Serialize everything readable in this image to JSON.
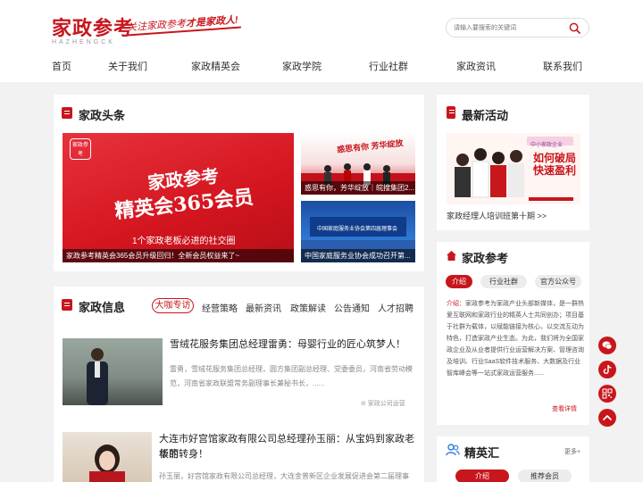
{
  "brand": {
    "logo_cn": "家政参考",
    "logo_en": "HAZHENGCK",
    "slogan_a": "关注家政参考",
    "slogan_b": "才是家政人!"
  },
  "search": {
    "placeholder": "请输入要搜索的关键词",
    "icon": "search-icon"
  },
  "nav": [
    "首页",
    "关于我们",
    "家政精英会",
    "家政学院",
    "行业社群",
    "家政资讯",
    "联系我们"
  ],
  "headlines": {
    "title": "家政头条",
    "main": {
      "caption": "家政参考精英会365会员升级回归！全新会员权益来了~",
      "img_line1": "家政参考",
      "img_line2": "精英会365会员",
      "img_line3": "1个家政老板必进的社交圈",
      "seal": "家政参考"
    },
    "side": [
      {
        "caption": "惑思有你，芳华绽放｜皖搜集团2...",
        "img_text": "惑思有你 芳华绽放"
      },
      {
        "caption": "中国家庭服务业协会成功召开第...",
        "img_text": "中国家庭服务业协会第四届理事会"
      }
    ]
  },
  "info": {
    "title": "家政信息",
    "tabs": [
      "大咖专访",
      "经营策略",
      "最新资讯",
      "政策解读",
      "公告通知",
      "人才招聘"
    ],
    "items": [
      {
        "title": "雪绒花服务集团总经理雷勇：母婴行业的匠心筑梦人！",
        "desc_line1": "雷勇，雪绒花服务集团总经理，圆方集团副总经理、党委委员，河南省劳动模",
        "desc_line2": "范，河南省家政联盟常务副理事长兼秘书长，......",
        "source": "家政公司运营"
      },
      {
        "title_line1": "大连市好宫馆家政有限公司总经理孙玉丽：从宝妈到家政老板的",
        "title_line2": "华丽转身！",
        "desc_line1": "孙玉丽，好宫馆家政有限公司总经理，大连金普新区企业发展促进会第二届理事"
      }
    ]
  },
  "activity": {
    "title": "最新活动",
    "caption": "家政经理人培训班第十期 >>",
    "img_tag": "中小家政企业",
    "img_line1": "如何破局",
    "img_line2": "快速盈利"
  },
  "reference": {
    "title": "家政参考",
    "tabs": [
      "介绍",
      "行业社群",
      "官方公众号"
    ],
    "intro_label": "介绍：",
    "intro_text": "家政参考为家政产业头部新媒体，是一群热爱互联网和家政行业的精英人士共同创办；项目基于社群为载体，以赋能链接为核心，以交流互动为特色，打造家政产业生态。为此，我们将为全国家政企业及从业者提供行业运营解决方案、管理咨询及培训、行业SaaS软件技术服务、大数据及行业智库峰会等一站式家政运营服务......",
    "more": "查看详情"
  },
  "elite": {
    "title": "精英汇",
    "more": "更多+",
    "tabs": [
      "介绍",
      "推荐会员"
    ]
  },
  "float_icons": [
    "wechat-icon",
    "douyin-icon",
    "qrcode-icon",
    "back-to-top-icon"
  ],
  "colors": {
    "brand_red": "#c8161d",
    "background": "#f2f2f2"
  }
}
